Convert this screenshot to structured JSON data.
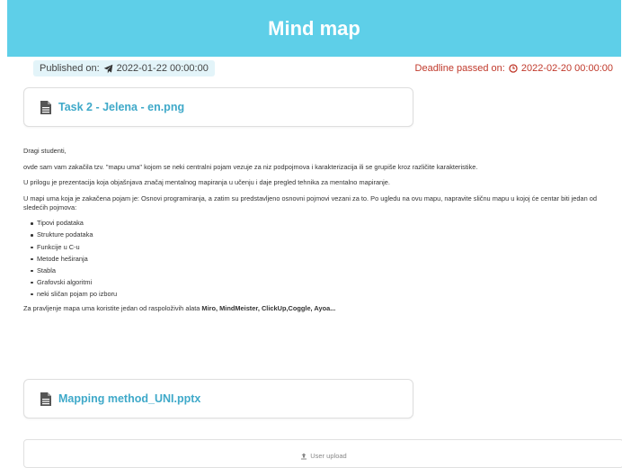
{
  "header": {
    "title": "Mind map",
    "background_color": "#5ecfe8"
  },
  "meta": {
    "published_label": "Published on:",
    "published_date": "2022-01-22 00:00:00",
    "deadline_label": "Deadline passed on:",
    "deadline_date": "2022-02-20 00:00:00",
    "deadline_color": "#c0392b"
  },
  "files": [
    {
      "name": "Task 2 - Jelena - en.png",
      "icon": "file-icon"
    },
    {
      "name": "Mapping method_UNI.pptx",
      "icon": "file-icon"
    }
  ],
  "content": {
    "greeting": "Dragi studenti,",
    "p1": "ovde sam vam zakačila tzv. \"mapu uma\" kojom se neki centralni pojam vezuje za niz podpojmova i karakterizacija ili se grupiše kroz različite karakteristike.",
    "p2": "U prilogu je prezentacija koja objašnjava značaj mentalnog mapiranja u učenju i daje pregled tehnika za mentalno mapiranje.",
    "p3": "U mapi uma koja je zakačena  pojam je: Osnovi programiranja, a zatim su predstavljeno osnovni pojmovi vezani za to. Po ugledu na ovu mapu, napravite sličnu mapu u kojoj će centar biti jedan od sledećih pojmova:",
    "list": [
      "Tipovi podataka",
      "Strukture podataka",
      "Funkcije u C-u",
      "Metode heširanja",
      "Stabla",
      "Grafovski algoritmi",
      "neki sličan pojam po izboru"
    ],
    "tools_prefix": "Za pravljenje mapa uma koristite jedan od raspoloživih alata ",
    "tools_bold": "Miro, MindMeister, ClickUp,Coggle, Ayoa..."
  },
  "upload": {
    "label": "User upload"
  }
}
